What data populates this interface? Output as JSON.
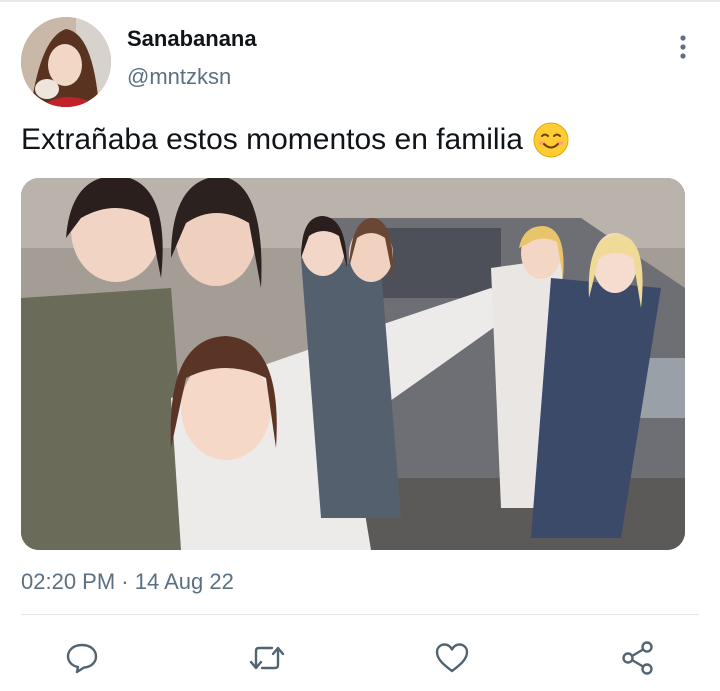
{
  "tweet": {
    "display_name": "Sanabanana",
    "handle": "@mntzksn",
    "text": "Extrañaba estos momentos en familia",
    "time": "02:20 PM",
    "separator": "·",
    "date": "14 Aug 22"
  },
  "icons": {
    "more": "more-vertical-icon",
    "emoji": "smiling-face-emoji",
    "reply": "reply-icon",
    "retweet": "retweet-icon",
    "like": "heart-icon",
    "share": "share-icon"
  },
  "colors": {
    "text": "#0f1419",
    "secondary": "#5b7083",
    "divider": "#e1e8ed",
    "icon": "#536471"
  }
}
